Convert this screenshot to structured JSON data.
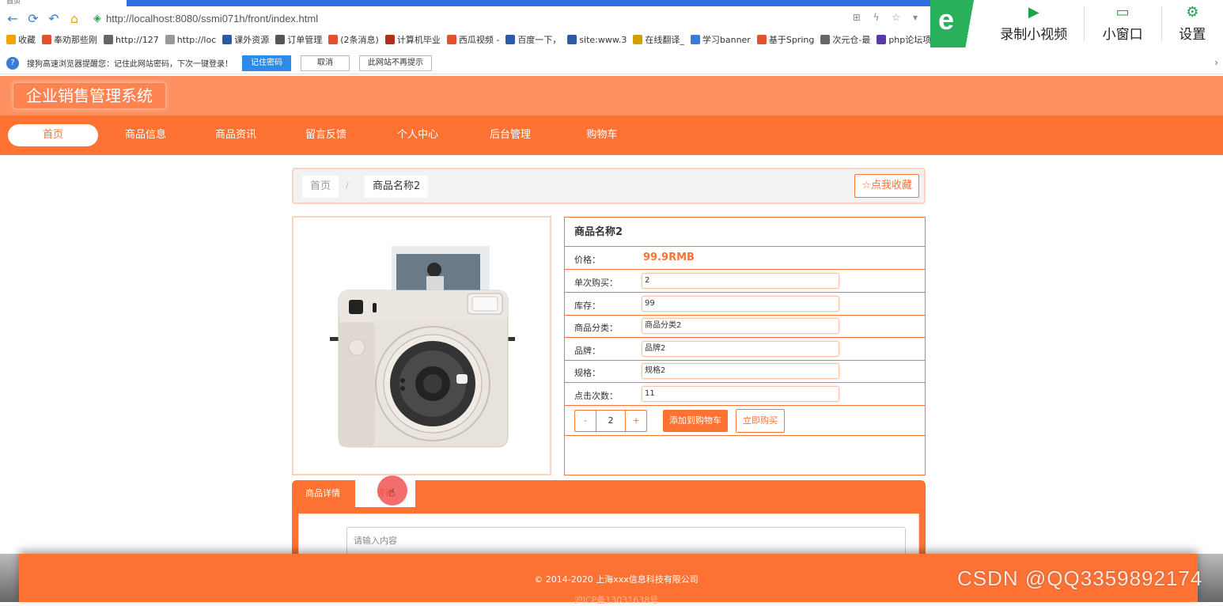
{
  "browser": {
    "tab_title": "首页",
    "url": "http://localhost:8080/ssmi071h/front/index.html",
    "bookmarks": [
      "收藏",
      "奉劝那些刚",
      "http://127",
      "http://loc",
      "课外资源",
      "订单管理",
      "(2条消息)",
      "计算机毕业",
      "西瓜视频 -",
      "百度一下，",
      "site:www.3",
      "在线翻译_",
      "学习banner",
      "基于Spring",
      "次元仓-最",
      "php论坛项"
    ],
    "password_bar": {
      "message": "搜狗高速浏览器提醒您：记住此网站密码，下次一键登录！",
      "remember": "记住密码",
      "cancel": "取消",
      "never": "此网站不再提示"
    },
    "ext": {
      "record": "录制小视频",
      "mini": "小窗口",
      "settings": "设置"
    }
  },
  "site": {
    "title": "企业销售管理系统",
    "nav": [
      "首页",
      "商品信息",
      "商品资讯",
      "留言反馈",
      "个人中心",
      "后台管理",
      "购物车"
    ]
  },
  "breadcrumb": {
    "home": "首页",
    "separator": "/",
    "current": "商品名称2",
    "favorite": "☆点我收藏"
  },
  "product": {
    "name": "商品名称2",
    "price_label": "价格：",
    "price": "99.9RMB",
    "fields": [
      {
        "label": "单次购买：",
        "value": "2"
      },
      {
        "label": "库存：",
        "value": "99"
      },
      {
        "label": "商品分类：",
        "value": "商品分类2"
      },
      {
        "label": "品牌：",
        "value": "品牌2"
      },
      {
        "label": "规格：",
        "value": "规格2"
      },
      {
        "label": "点击次数：",
        "value": "11"
      }
    ],
    "qty_minus": "-",
    "qty_value": "2",
    "qty_plus": "+",
    "add_to_cart": "添加到购物车",
    "buy_now": "立即购买"
  },
  "tabs": {
    "detail": "商品详情",
    "comment": "评论",
    "comment_placeholder": "请输入内容"
  },
  "footer": {
    "copyright": "© 2014-2020 上海xxx信息科技有限公司",
    "icp": "沪ICP备13031638号"
  },
  "watermark": "CSDN @QQ3359892174",
  "colors": {
    "primary": "#fe7234",
    "header": "#fd9060",
    "sogou_green": "#1aa34a"
  }
}
